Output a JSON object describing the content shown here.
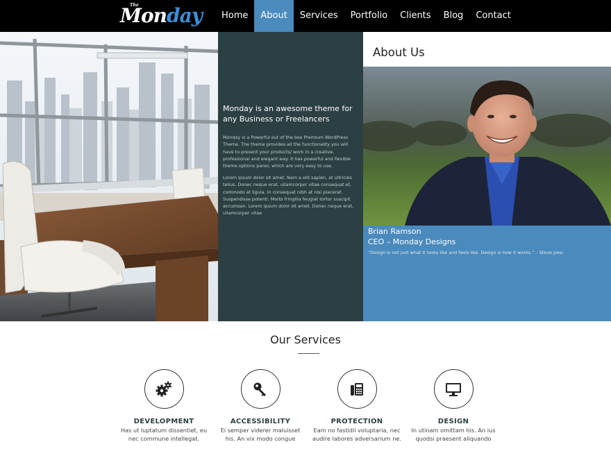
{
  "brand": {
    "the": "The",
    "word_part1": "Mon",
    "word_part2": "day",
    "accent": "#3d8ed4"
  },
  "nav": {
    "items": [
      {
        "label": "Home",
        "active": false
      },
      {
        "label": "About",
        "active": true
      },
      {
        "label": "Services",
        "active": false
      },
      {
        "label": "Portfolio",
        "active": false
      },
      {
        "label": "Clients",
        "active": false
      },
      {
        "label": "Blog",
        "active": false
      },
      {
        "label": "Contact",
        "active": false
      }
    ],
    "active_color": "#4a8abd"
  },
  "intro": {
    "heading": "Monday is an awesome theme for any Business or Freelancers",
    "paragraph1": "Monday is a Powerful out of the box Premium WordPress Theme. The theme provides all the functionality you will have to present your products/ work in a creative, professional and elegant way. It has powerful and flexible theme options panel, which are very easy to use.",
    "paragraph2": "Lorem ipsum dolor sit amet. Nam a elit sapien, at ultricies tellus. Donec neque erat, ullamcorper vitae consequat et, commodo at ligula. In consequat nibh at nisi placerat. Suspendisse potenti. Morbi fringilla feugiat tortor suscipit accumsan. Lorem ipsum dolor sit amet. Donec neque erat, ullamcorper vitae",
    "panel_color": "#2c3f42"
  },
  "about": {
    "title": "About Us",
    "name": "Brian Ramson",
    "role": "CEO – Monday Designs",
    "quote": "“Design is not just what it looks like and feels like. Design is how it works.” – Steve Jobs.",
    "panel_color": "#4a8abd"
  },
  "services": {
    "title": "Our Services",
    "items": [
      {
        "icon": "gears-icon",
        "title": "DEVELOPMENT",
        "line1": "Has ut luptatum dissentiet, eu",
        "line2": "nec commune intellegat."
      },
      {
        "icon": "key-icon",
        "title": "ACCESSIBILITY",
        "line1": "Ei semper viderer maluisset",
        "line2": "his. An vix modo congue"
      },
      {
        "icon": "fax-icon",
        "title": "PROTECTION",
        "line1": "Eam no fastidii voluptaria, nec",
        "line2": "audire labores adversarium ne."
      },
      {
        "icon": "monitor-icon",
        "title": "DESIGN",
        "line1": "In utinam omittam his. An ius",
        "line2": "quodsi praesent aliquando"
      }
    ]
  }
}
